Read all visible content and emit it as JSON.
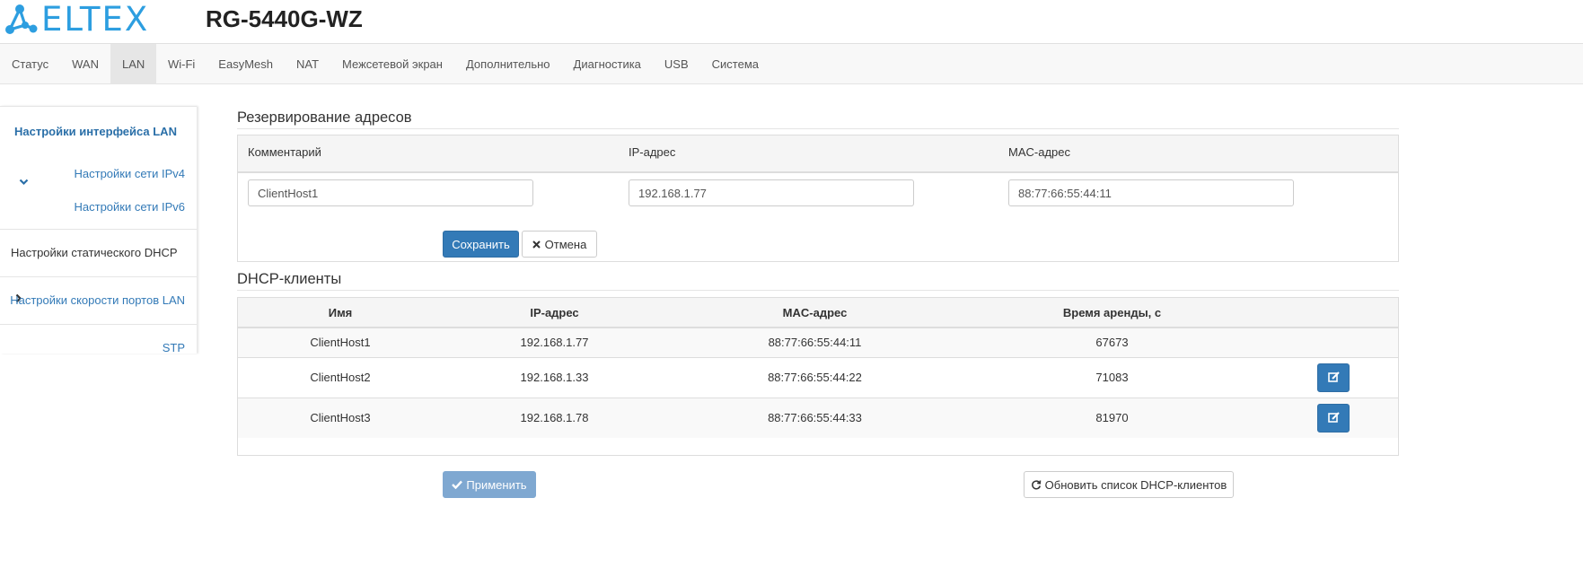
{
  "brand": {
    "logo_text": "ELTEX",
    "model": "RG-5440G-WZ",
    "logo_color": "#2d9ee0"
  },
  "nav": {
    "items": [
      {
        "label": "Статус",
        "active": false
      },
      {
        "label": "WAN",
        "active": false
      },
      {
        "label": "LAN",
        "active": true
      },
      {
        "label": "Wi-Fi",
        "active": false
      },
      {
        "label": "EasyMesh",
        "active": false
      },
      {
        "label": "NAT",
        "active": false
      },
      {
        "label": "Межсетевой экран",
        "active": false
      },
      {
        "label": "Дополнительно",
        "active": false
      },
      {
        "label": "Диагностика",
        "active": false
      },
      {
        "label": "USB",
        "active": false
      },
      {
        "label": "Система",
        "active": false
      }
    ]
  },
  "sidebar": {
    "lan_interface": "Настройки интерфейса LAN",
    "ipv4": "Настройки сети IPv4",
    "ipv6": "Настройки сети IPv6",
    "static_dhcp": "Настройки статического DHCP",
    "port_speed": "Настройки скорости портов LAN",
    "stp": "STP"
  },
  "reservation": {
    "title": "Резервирование адресов",
    "col_comment": "Комментарий",
    "col_ip": "IP-адрес",
    "col_mac": "MAC-адрес",
    "comment_value": "ClientHost1",
    "ip_value": "192.168.1.77",
    "mac_value": "88:77:66:55:44:11",
    "save_label": "Сохранить",
    "cancel_label": "Отмена"
  },
  "dhcp_clients": {
    "title": "DHCP-клиенты",
    "headers": [
      "Имя",
      "IP-адрес",
      "MAC-адрес",
      "Время аренды, с"
    ],
    "rows": [
      {
        "name": "ClientHost1",
        "ip": "192.168.1.77",
        "mac": "88:77:66:55:44:11",
        "lease": "67673",
        "editable": false
      },
      {
        "name": "ClientHost2",
        "ip": "192.168.1.33",
        "mac": "88:77:66:55:44:22",
        "lease": "71083",
        "editable": true
      },
      {
        "name": "ClientHost3",
        "ip": "192.168.1.78",
        "mac": "88:77:66:55:44:33",
        "lease": "81970",
        "editable": true
      }
    ]
  },
  "footer": {
    "apply_label": "Применить",
    "refresh_label": "Обновить список DHCP-клиентов"
  },
  "colors": {
    "primary": "#337ab7",
    "link": "#337ab7",
    "disabled_primary": "#7fa8d1"
  }
}
